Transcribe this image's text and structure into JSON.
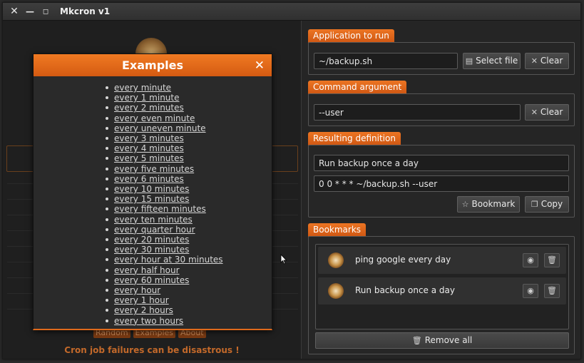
{
  "window": {
    "title": "Mkcron v1"
  },
  "titlebar": {
    "close_glyph": "✕",
    "minimize_glyph": "—",
    "maximize_glyph": "◻"
  },
  "left": {
    "buttons": [
      "Random",
      "Examples",
      "About"
    ],
    "tagline": "Cron job failures can be disastrous !"
  },
  "modal": {
    "title": "Examples",
    "close_glyph": "✕",
    "items": [
      "every minute",
      "every 1 minute",
      "every 2 minutes",
      "every even minute",
      "every uneven minute",
      "every 3 minutes",
      "every 4 minutes",
      "every 5 minutes",
      "every five minutes",
      "every 6 minutes",
      "every 10 minutes",
      "every 15 minutes",
      "every fifteen minutes",
      "every ten minutes",
      "every quarter hour",
      "every 20 minutes",
      "every 30 minutes",
      "every hour at 30 minutes",
      "every half hour",
      "every 60 minutes",
      "every hour",
      "every 1 hour",
      "every 2 hours",
      "every two hours"
    ]
  },
  "app": {
    "title": "Application to run",
    "value": "~/backup.sh",
    "select_file": "Select file",
    "clear": "Clear"
  },
  "arg": {
    "title": "Command argument",
    "value": "--user",
    "clear": "Clear"
  },
  "result": {
    "title": "Resulting definition",
    "description": "Run backup once a day",
    "definition": "0 0 * * * ~/backup.sh --user",
    "bookmark": "Bookmark",
    "copy": "Copy"
  },
  "bookmarks": {
    "title": "Bookmarks",
    "items": [
      "ping google every day",
      "Run backup once a day"
    ],
    "remove_all": "Remove all"
  },
  "icons": {
    "file": "file-icon",
    "clear": "close-icon",
    "star": "star-icon",
    "copy": "copy-icon",
    "eye": "eye-icon",
    "trash": "trash-icon",
    "clock": "clock-icon"
  },
  "colors": {
    "accent": "#e06a1b",
    "background": "#222222"
  }
}
